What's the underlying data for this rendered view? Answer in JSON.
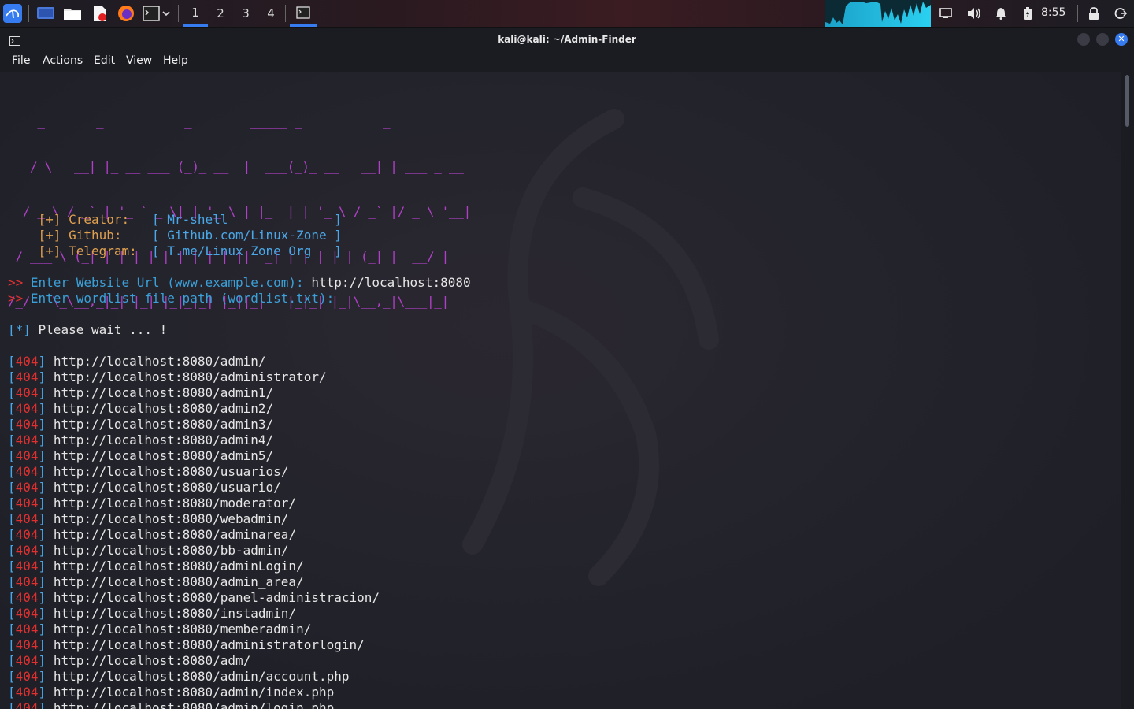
{
  "taskbar": {
    "workspaces": [
      "1",
      "2",
      "3",
      "4"
    ],
    "clock": "8:55"
  },
  "window": {
    "title": "kali@kali: ~/Admin-Finder",
    "menu": [
      "File",
      "Actions",
      "Edit",
      "View",
      "Help"
    ]
  },
  "terminal": {
    "banner": [
      "    _       _           _        _____ _           _           ",
      "   / \\   __| |_ __ ___ (_)_ __  |  ___(_)_ __   __| | ___ _ __ ",
      "  / _ \\ / _` | '_ ` _ \\| | '_ \\ | |_  | | '_ \\ / _` |/ _ \\ '__|",
      " / ___ \\ (_| | | | | | | | | | ||  _| | | | | | (_| |  __/ |   ",
      "/_/   \\_\\__,_|_| |_| |_|_|_| |_||_|   |_|_| |_|\\__,_|\\___|_|   "
    ],
    "info": [
      {
        "prefix": "[+] Creator:  ",
        "open": " [ ",
        "value": "Mr-shell              ",
        "close": "]"
      },
      {
        "prefix": "[+] Github:   ",
        "open": " [ ",
        "value": "Github.com/Linux-Zone ",
        "close": "]"
      },
      {
        "prefix": "[+] Telegram: ",
        "open": " [ ",
        "value": "T.me/Linux_Zone_Org   ",
        "close": "]"
      }
    ],
    "prompt_marker": ">>",
    "prompt_url": " Enter Website Url (www.example.com): ",
    "prompt_url_value": "http://localhost:8080",
    "prompt_wordlist": " Enter wordlist file path (wordlist.txt):",
    "wait_marker": "[*]",
    "wait_text": " Please wait ... !",
    "status_code": "404",
    "results": [
      "http://localhost:8080/admin/",
      "http://localhost:8080/administrator/",
      "http://localhost:8080/admin1/",
      "http://localhost:8080/admin2/",
      "http://localhost:8080/admin3/",
      "http://localhost:8080/admin4/",
      "http://localhost:8080/admin5/",
      "http://localhost:8080/usuarios/",
      "http://localhost:8080/usuario/",
      "http://localhost:8080/moderator/",
      "http://localhost:8080/webadmin/",
      "http://localhost:8080/adminarea/",
      "http://localhost:8080/bb-admin/",
      "http://localhost:8080/adminLogin/",
      "http://localhost:8080/admin_area/",
      "http://localhost:8080/panel-administracion/",
      "http://localhost:8080/instadmin/",
      "http://localhost:8080/memberadmin/",
      "http://localhost:8080/administratorlogin/",
      "http://localhost:8080/adm/",
      "http://localhost:8080/admin/account.php",
      "http://localhost:8080/admin/index.php",
      "http://localhost:8080/admin/login.php"
    ]
  },
  "colors": {
    "accent": "#367bf0",
    "banner": "#b040c8",
    "status_error": "#e03030",
    "prompt_text": "#3ba0d8"
  }
}
